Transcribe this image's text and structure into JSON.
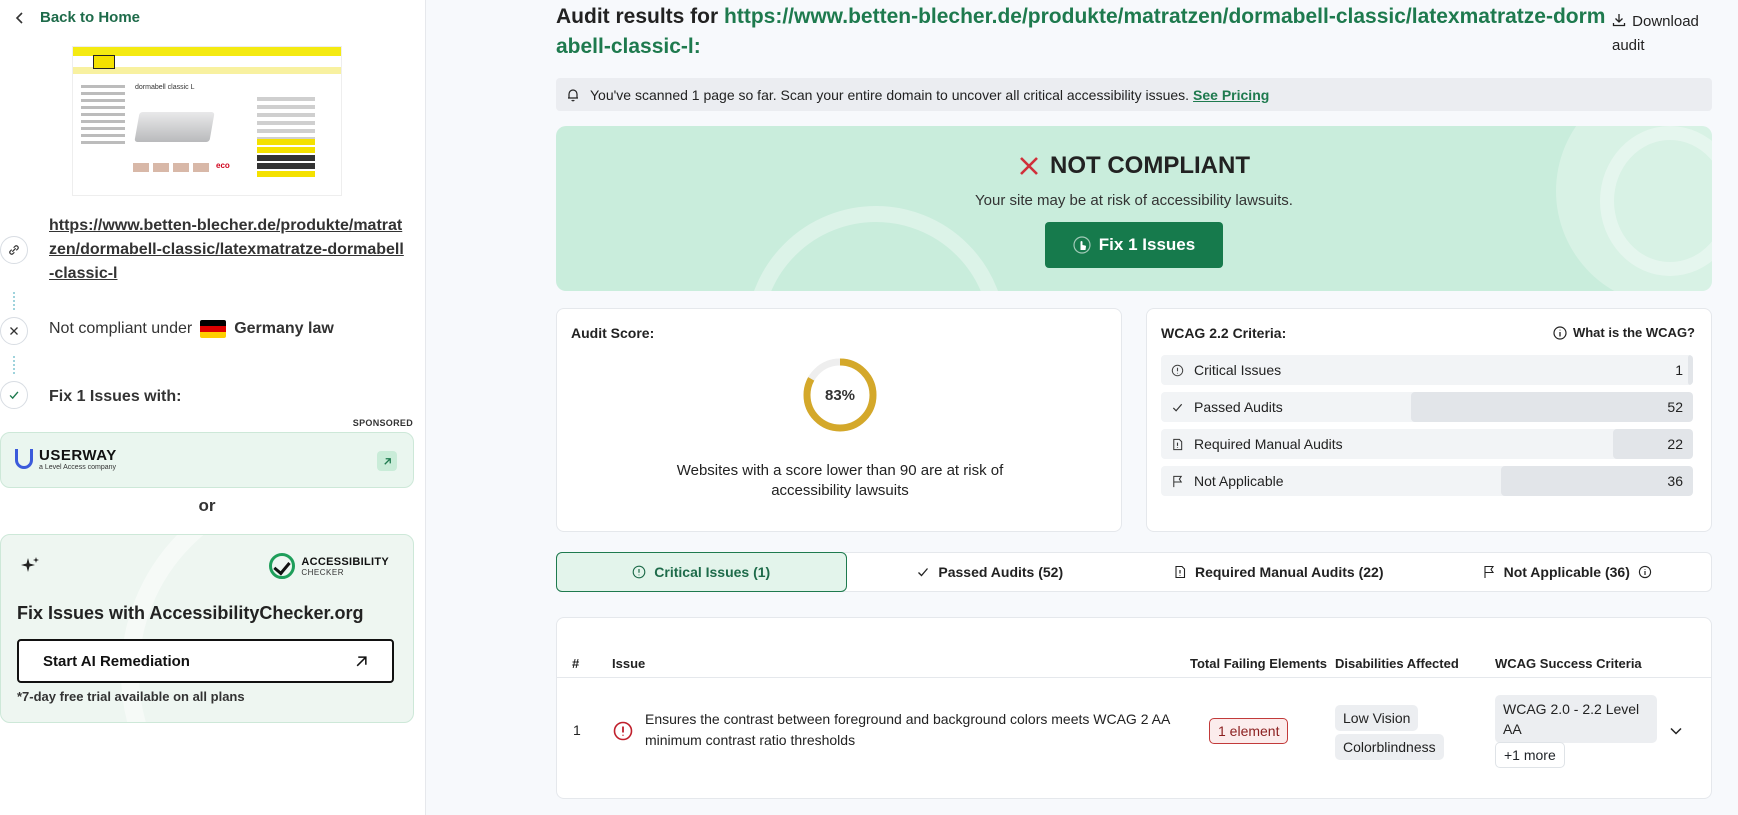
{
  "sidebar": {
    "back_label": "Back to Home",
    "url": "https://www.betten-blecher.de/produkte/matratzen/dormabell-classic/latexmatratze-dormabell-classic-l",
    "thumb_title": "dormabell classic L",
    "compliance_prefix": "Not compliant under",
    "compliance_law": "Germany law",
    "fix_with": "Fix 1 Issues with:",
    "sponsored": "SPONSORED",
    "userway_name": "USERWAY",
    "userway_sub": "a Level Access company",
    "or": "or",
    "ac_logo_name": "ACCESSIBILITY",
    "ac_logo_sub": "CHECKER",
    "ac_heading": "Fix Issues with AccessibilityChecker.org",
    "ai_button": "Start AI Remediation",
    "trial": "*7-day free trial available on all plans"
  },
  "header": {
    "title_prefix": "Audit results for",
    "url": "https://www.betten-blecher.de/produkte/matratzen/dormabell-classic/latexmatratze-dormabell-classic-l:",
    "download": "Download audit"
  },
  "notice": {
    "text": "You've scanned 1 page so far. Scan your entire domain to uncover all critical accessibility issues.",
    "link": "See Pricing"
  },
  "banner": {
    "status": "NOT COMPLIANT",
    "subtitle": "Your site may be at risk of accessibility lawsuits.",
    "button": "Fix 1 Issues"
  },
  "score": {
    "title": "Audit Score:",
    "value": 83,
    "display": "83%",
    "note": "Websites with a score lower than 90 are at risk of accessibility lawsuits",
    "ring_color": "#d4a82a"
  },
  "wcag": {
    "title": "WCAG 2.2 Criteria:",
    "help": "What is the WCAG?",
    "rows": [
      {
        "label": "Critical Issues",
        "value": "1",
        "fill": 0.01
      },
      {
        "label": "Passed Audits",
        "value": "52",
        "fill": 0.53
      },
      {
        "label": "Required Manual Audits",
        "value": "22",
        "fill": 0.15
      },
      {
        "label": "Not Applicable",
        "value": "36",
        "fill": 0.36
      }
    ]
  },
  "tabs": [
    {
      "label": "Critical Issues (1)"
    },
    {
      "label": "Passed Audits (52)"
    },
    {
      "label": "Required Manual Audits (22)"
    },
    {
      "label": "Not Applicable (36)"
    }
  ],
  "table": {
    "headers": {
      "num": "#",
      "issue": "Issue",
      "failing": "Total Failing Elements",
      "disabilities": "Disabilities Affected",
      "criteria": "WCAG Success Criteria"
    },
    "rows": [
      {
        "num": "1",
        "issue": "Ensures the contrast between foreground and background colors meets WCAG 2 AA minimum contrast ratio thresholds",
        "elements": "1 element",
        "disabilities": [
          "Low Vision",
          "Colorblindness"
        ],
        "criteria": "WCAG 2.0 - 2.2 Level AA",
        "more": "+1 more"
      }
    ]
  },
  "colors": {
    "brand_green": "#167a4c",
    "banner_bg": "#c9eddc",
    "danger": "#d0303a"
  }
}
